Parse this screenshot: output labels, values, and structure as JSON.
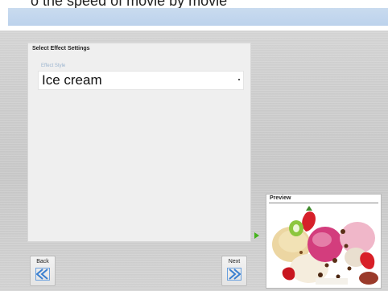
{
  "header": {
    "partial_title": "o the speed of movie by movie"
  },
  "panel": {
    "title": "Select Effect Settings",
    "field_label": "Effect Style",
    "selected_value": "Ice cream"
  },
  "preview": {
    "title": "Preview",
    "image_description_icon": "ice-cream-image"
  },
  "nav": {
    "back_label": "Back",
    "next_label": "Next"
  },
  "colors": {
    "accent_band": "#bcd2ec",
    "play_marker": "#46b41e",
    "arrow_icon": "#3a7fd0"
  }
}
